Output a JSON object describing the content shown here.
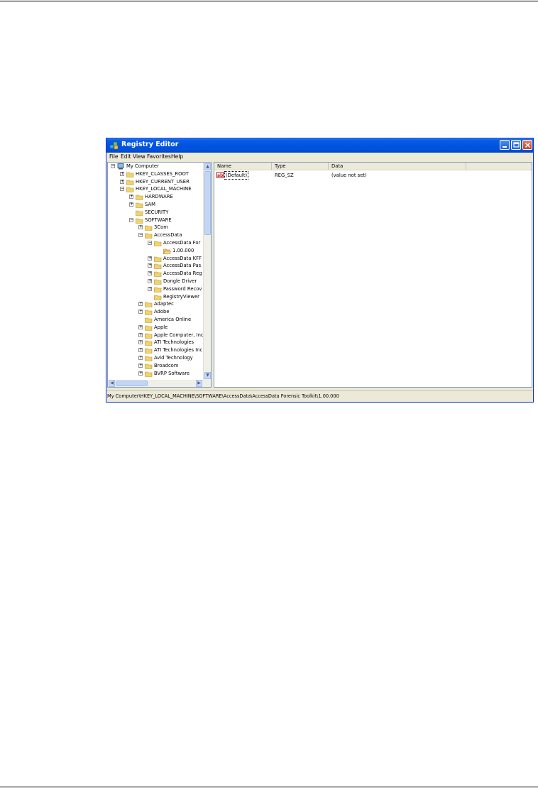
{
  "window": {
    "title": "Registry Editor",
    "titlebar_color": "#0054e3",
    "close_color": "#c8422a"
  },
  "menu": [
    "File",
    "Edit",
    "View",
    "Favorites",
    "Help"
  ],
  "tree": [
    {
      "label": "My Computer",
      "expander": "minus",
      "icon": "computer-icon"
    },
    {
      "label": "HKEY_CLASSES_ROOT",
      "expander": "plus",
      "icon": "folder-icon"
    },
    {
      "label": "HKEY_CURRENT_USER",
      "expander": "plus",
      "icon": "folder-icon"
    },
    {
      "label": "HKEY_LOCAL_MACHINE",
      "expander": "minus",
      "icon": "folder-icon"
    },
    {
      "label": "HARDWARE",
      "expander": "plus",
      "icon": "folder-icon"
    },
    {
      "label": "SAM",
      "expander": "plus",
      "icon": "folder-icon"
    },
    {
      "label": "SECURITY",
      "expander": "none",
      "icon": "folder-icon"
    },
    {
      "label": "SOFTWARE",
      "expander": "minus",
      "icon": "folder-icon"
    },
    {
      "label": "3Com",
      "expander": "plus",
      "icon": "folder-icon"
    },
    {
      "label": "AccessData",
      "expander": "minus",
      "icon": "folder-icon"
    },
    {
      "label": "AccessData For",
      "expander": "minus",
      "icon": "folder-icon"
    },
    {
      "label": "1.00.000",
      "expander": "none",
      "icon": "open-folder-icon",
      "selected": true
    },
    {
      "label": "AccessData KFF",
      "expander": "plus",
      "icon": "folder-icon"
    },
    {
      "label": "AccessData Pas",
      "expander": "plus",
      "icon": "folder-icon"
    },
    {
      "label": "AccessData Reg",
      "expander": "plus",
      "icon": "folder-icon"
    },
    {
      "label": "Dongle Driver",
      "expander": "plus",
      "icon": "folder-icon"
    },
    {
      "label": "Password Recov",
      "expander": "plus",
      "icon": "folder-icon"
    },
    {
      "label": "RegistryViewer",
      "expander": "none",
      "icon": "folder-icon"
    },
    {
      "label": "Adaptec",
      "expander": "plus",
      "icon": "folder-icon"
    },
    {
      "label": "Adobe",
      "expander": "plus",
      "icon": "folder-icon"
    },
    {
      "label": "America Online",
      "expander": "none",
      "icon": "folder-icon"
    },
    {
      "label": "Apple",
      "expander": "plus",
      "icon": "folder-icon"
    },
    {
      "label": "Apple Computer, Inc",
      "expander": "plus",
      "icon": "folder-icon"
    },
    {
      "label": "ATI Technologies",
      "expander": "plus",
      "icon": "folder-icon"
    },
    {
      "label": "ATI Technologies Inc",
      "expander": "plus",
      "icon": "folder-icon"
    },
    {
      "label": "Avid Technology",
      "expander": "plus",
      "icon": "folder-icon"
    },
    {
      "label": "Broadcom",
      "expander": "plus",
      "icon": "folder-icon"
    },
    {
      "label": "BVRP Software",
      "expander": "plus",
      "icon": "folder-icon"
    }
  ],
  "list": {
    "columns": [
      "Name",
      "Type",
      "Data"
    ],
    "rows": [
      {
        "name": "(Default)",
        "type": "REG_SZ",
        "data": "(value not set)",
        "icon": "string-value-icon"
      }
    ]
  },
  "status": {
    "path": "My Computer\\HKEY_LOCAL_MACHINE\\SOFTWARE\\AccessData\\AccessData Forensic Toolkit\\1.00.000"
  }
}
